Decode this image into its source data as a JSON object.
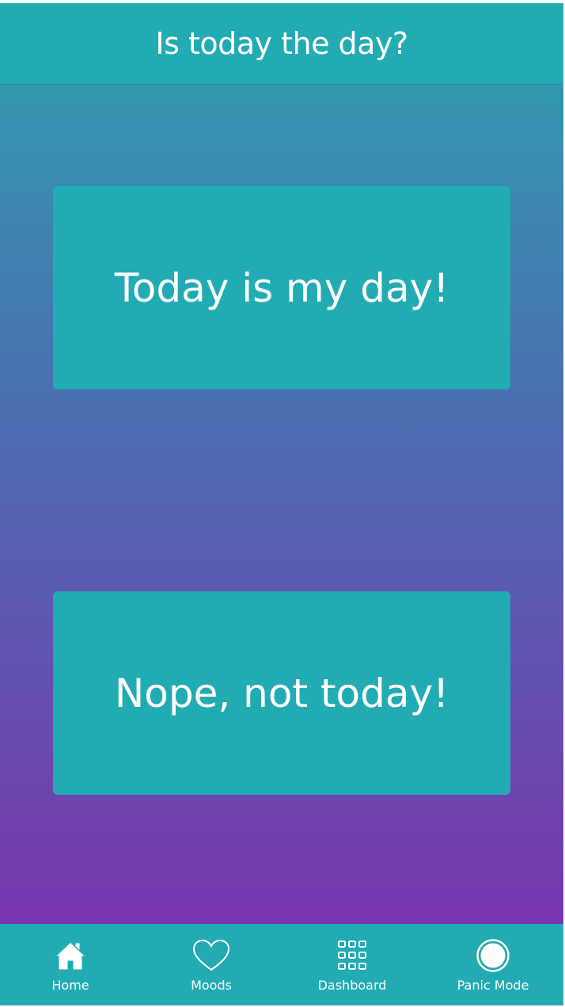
{
  "header": {
    "title": "Is today the day?"
  },
  "choices": {
    "yes_label": "Today is my day!",
    "no_label": "Nope, not today!"
  },
  "tabbar": {
    "items": [
      {
        "label": "Home",
        "icon": "home-icon"
      },
      {
        "label": "Moods",
        "icon": "heart-icon"
      },
      {
        "label": "Dashboard",
        "icon": "grid-icon"
      },
      {
        "label": "Panic Mode",
        "icon": "record-icon"
      }
    ]
  },
  "colors": {
    "accent": "#22abb3",
    "gradient_top": "#2ba3b1",
    "gradient_bottom": "#7d2caf",
    "text": "#ffffff"
  }
}
